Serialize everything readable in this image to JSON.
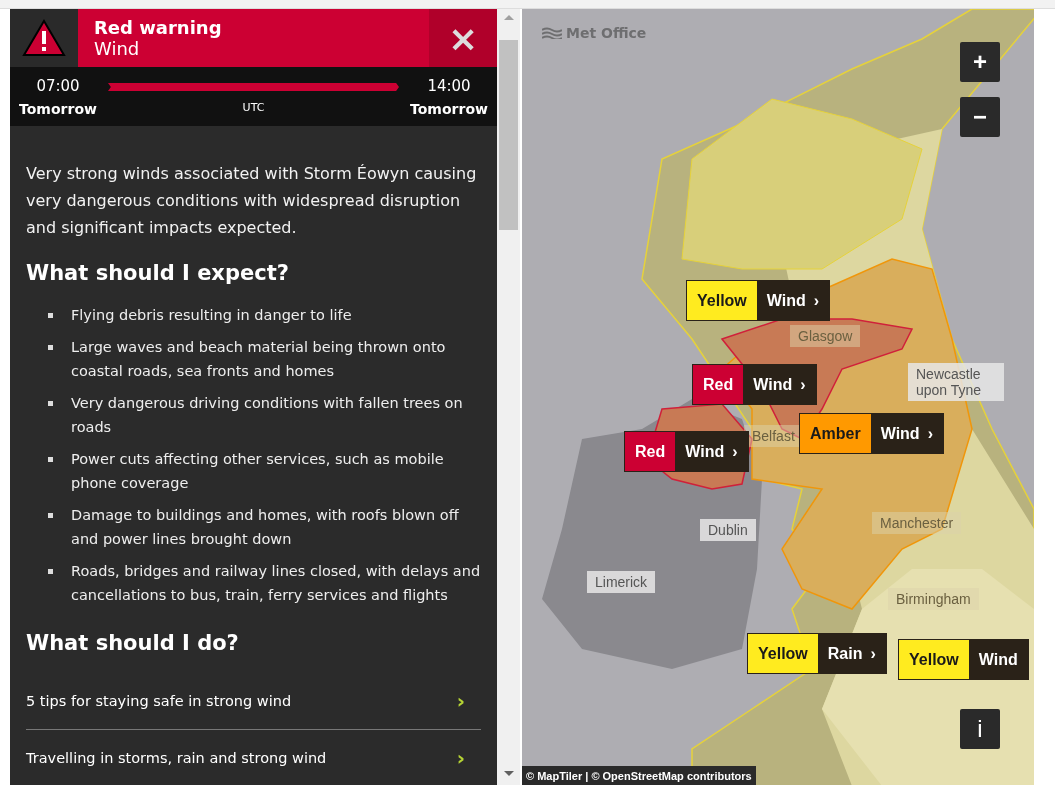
{
  "warning": {
    "kind": "red",
    "title": "Red warning",
    "type": "Wind",
    "close_label": "×"
  },
  "timeline": {
    "start_time": "07:00",
    "start_day": "Tomorrow",
    "zone": "UTC",
    "end_time": "14:00",
    "end_day": "Tomorrow"
  },
  "summary": "Very strong winds associated with Storm Éowyn causing very dangerous conditions with widespread disruption and significant impacts expected.",
  "expect": {
    "heading": "What should I expect?",
    "items": [
      "Flying debris resulting in danger to life",
      "Large waves and beach material being thrown onto coastal roads, sea fronts and homes",
      "Very dangerous driving conditions with fallen trees on roads",
      "Power cuts affecting other services, such as mobile phone coverage",
      "Damage to buildings and homes, with roofs blown off and power lines brought down",
      "Roads, bridges and railway lines closed, with delays and cancellations to bus, train, ferry services and flights"
    ]
  },
  "do": {
    "heading": "What should I do?",
    "links": [
      {
        "label": "5 tips for staying safe in strong wind",
        "arrow": "›"
      },
      {
        "label": "Travelling in storms, rain and strong wind",
        "arrow": "›"
      }
    ]
  },
  "map": {
    "logo": "Met Office",
    "zoom_in": "+",
    "zoom_out": "−",
    "info": "i",
    "attribution": "© MapTiler | © OpenStreetMap contributors",
    "places": [
      "Glasgow",
      "Newcastle upon Tyne",
      "Belfast",
      "Dublin",
      "Manchester",
      "Limerick",
      "Birmingham"
    ],
    "warnings": [
      {
        "kind": "yellow",
        "level": "Yellow",
        "type": "Wind",
        "arrow": "›"
      },
      {
        "kind": "red",
        "level": "Red",
        "type": "Wind",
        "arrow": "›"
      },
      {
        "kind": "amber",
        "level": "Amber",
        "type": "Wind",
        "arrow": "›"
      },
      {
        "kind": "red",
        "level": "Red",
        "type": "Wind",
        "arrow": "›"
      },
      {
        "kind": "yellow",
        "level": "Yellow",
        "type": "Rain",
        "arrow": "›"
      },
      {
        "kind": "yellow",
        "level": "Yellow",
        "type": "Wind"
      }
    ]
  }
}
